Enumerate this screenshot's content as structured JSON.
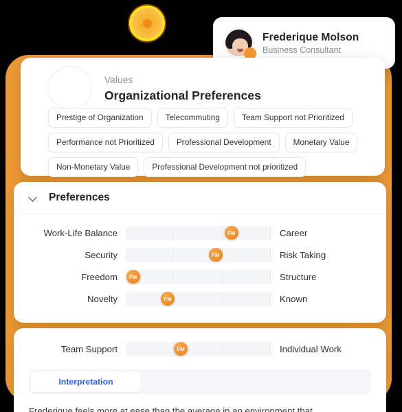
{
  "badge": {
    "icon": "sun-badge-icon"
  },
  "profile": {
    "name": "Frederique Molson",
    "role": "Business Consultant",
    "avatar_icon": "user-avatar",
    "status_icon": "online-status-dot"
  },
  "values_card": {
    "kicker": "Values",
    "title": "Organizational Preferences",
    "logo_icon": "organization-logo-placeholder",
    "tags": [
      "Prestige of Organization",
      "Telecommuting",
      "Team Support not Prioritized",
      "Performance not Prioritized",
      "Professional Development",
      "Monetary Value",
      "Non-Monetary Value",
      "Professional Development not prioritized"
    ]
  },
  "preferences": {
    "header": "Preferences",
    "chevron_icon": "chevron-down-icon",
    "thumb_initials": "FM",
    "sliders": [
      {
        "left": "Work-Life Balance",
        "right": "Career",
        "value": 73
      },
      {
        "left": "Security",
        "right": "Risk Taking",
        "value": 62
      },
      {
        "left": "Freedom",
        "right": "Structure",
        "value": 5
      },
      {
        "left": "Novelty",
        "right": "Known",
        "value": 29
      }
    ]
  },
  "bottom": {
    "slider": {
      "left": "Team Support",
      "right": "Individual Work",
      "value": 38
    },
    "thumb_initials": "FM",
    "tab_label": "Interpretation",
    "body_text": "Frederique feels more at ease than the average in an environment that"
  },
  "colors": {
    "accent_orange": "#ED9A35",
    "thumb_orange": "#F0922E",
    "link_blue": "#2563EB",
    "text_dark": "#22262B",
    "text_muted": "#8B9097"
  },
  "chart_data": {
    "type": "bar",
    "title": "Organizational Preferences",
    "xlabel": "",
    "ylabel": "",
    "xlim": [
      0,
      100
    ],
    "grid": true,
    "legend": "none",
    "categories": [
      "Work-Life Balance → Career",
      "Security → Risk Taking",
      "Freedom → Structure",
      "Novelty → Known",
      "Team Support → Individual Work"
    ],
    "values": [
      73,
      62,
      5,
      29,
      38
    ],
    "annotations": [
      "FM",
      "FM",
      "FM",
      "FM",
      "FM"
    ]
  }
}
